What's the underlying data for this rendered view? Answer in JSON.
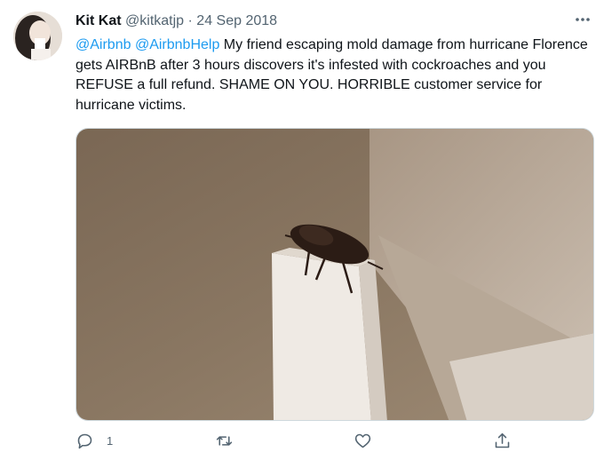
{
  "tweet": {
    "author_name": "Kit Kat",
    "handle": "@kitkatjp",
    "separator": "·",
    "date": "24 Sep 2018",
    "more_icon": "more-icon",
    "mention_1": "@Airbnb",
    "mention_2": "@AirbnbHelp",
    "body": " My friend escaping mold damage from hurricane Florence gets AIRBnB after 3 hours discovers it's infested with cockroaches and you REFUSE a full refund.  SHAME ON YOU.  HORRIBLE customer service for hurricane victims."
  },
  "actions": {
    "reply_icon": "reply-icon",
    "reply_count": "1",
    "retweet_icon": "retweet-icon",
    "like_icon": "heart-icon",
    "share_icon": "share-icon"
  },
  "colors": {
    "link": "#1d9bf0",
    "secondary_text": "#536471"
  }
}
